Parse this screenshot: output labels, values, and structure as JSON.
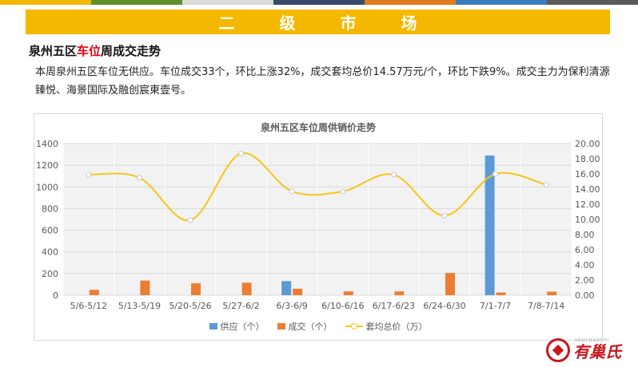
{
  "header": {
    "stripe_colors": [
      "#f5b800",
      "#5b8f2d",
      "#d9d9d9",
      "#374a6d",
      "#e07b1e",
      "#3a7bbf",
      "#5a5a5a"
    ],
    "banner_title": "二级市场",
    "banner_color": "#f5b800"
  },
  "section": {
    "heading_pre": "泉州五区",
    "heading_highlight": "车位",
    "heading_post": "周成交走势",
    "paragraph": "本周泉州五区车位无供应。车位成交33个，环比上涨32%，成交套均总价14.57万元/个，环比下跌9%。成交主力为保利清源臻悦、海景国际及融创宸東壹号。"
  },
  "chart_data": {
    "type": "bar",
    "title": "泉州五区车位周供销价走势",
    "categories": [
      "5/6-5/12",
      "5/13-5/19",
      "5/20-5/26",
      "5/27-6/2",
      "6/3-6/9",
      "6/10-6/16",
      "6/17-6/23",
      "6/24-6/30",
      "7/1-7/7",
      "7/8-7/14"
    ],
    "series": [
      {
        "name": "供应（个）",
        "kind": "bar",
        "axis": "left",
        "color": "#5b9bd5",
        "values": [
          0,
          0,
          0,
          0,
          130,
          0,
          0,
          0,
          1290,
          0
        ]
      },
      {
        "name": "成交（个）",
        "kind": "bar",
        "axis": "left",
        "color": "#ed7d31",
        "values": [
          50,
          135,
          110,
          115,
          60,
          35,
          35,
          205,
          25,
          33
        ]
      },
      {
        "name": "套均总价（万）",
        "kind": "line",
        "axis": "right",
        "color": "#f5c518",
        "values": [
          15.9,
          15.5,
          9.9,
          18.7,
          13.7,
          13.7,
          15.9,
          10.5,
          16.0,
          14.57
        ]
      }
    ],
    "ylim_left": [
      0,
      1400
    ],
    "yticks_left": [
      "0",
      "200",
      "400",
      "600",
      "800",
      "1000",
      "1200",
      "1400"
    ],
    "ylim_right": [
      0,
      20
    ],
    "yticks_right": [
      "0.00",
      "2.00",
      "4.00",
      "6.00",
      "8.00",
      "10.00",
      "12.00",
      "14.00",
      "16.00",
      "18.00",
      "20.00"
    ],
    "grid": true,
    "legend_position": "bottom"
  },
  "brand": {
    "logo_text": "有巢氏",
    "logo_subtext": "YOUCHAOSHI"
  }
}
